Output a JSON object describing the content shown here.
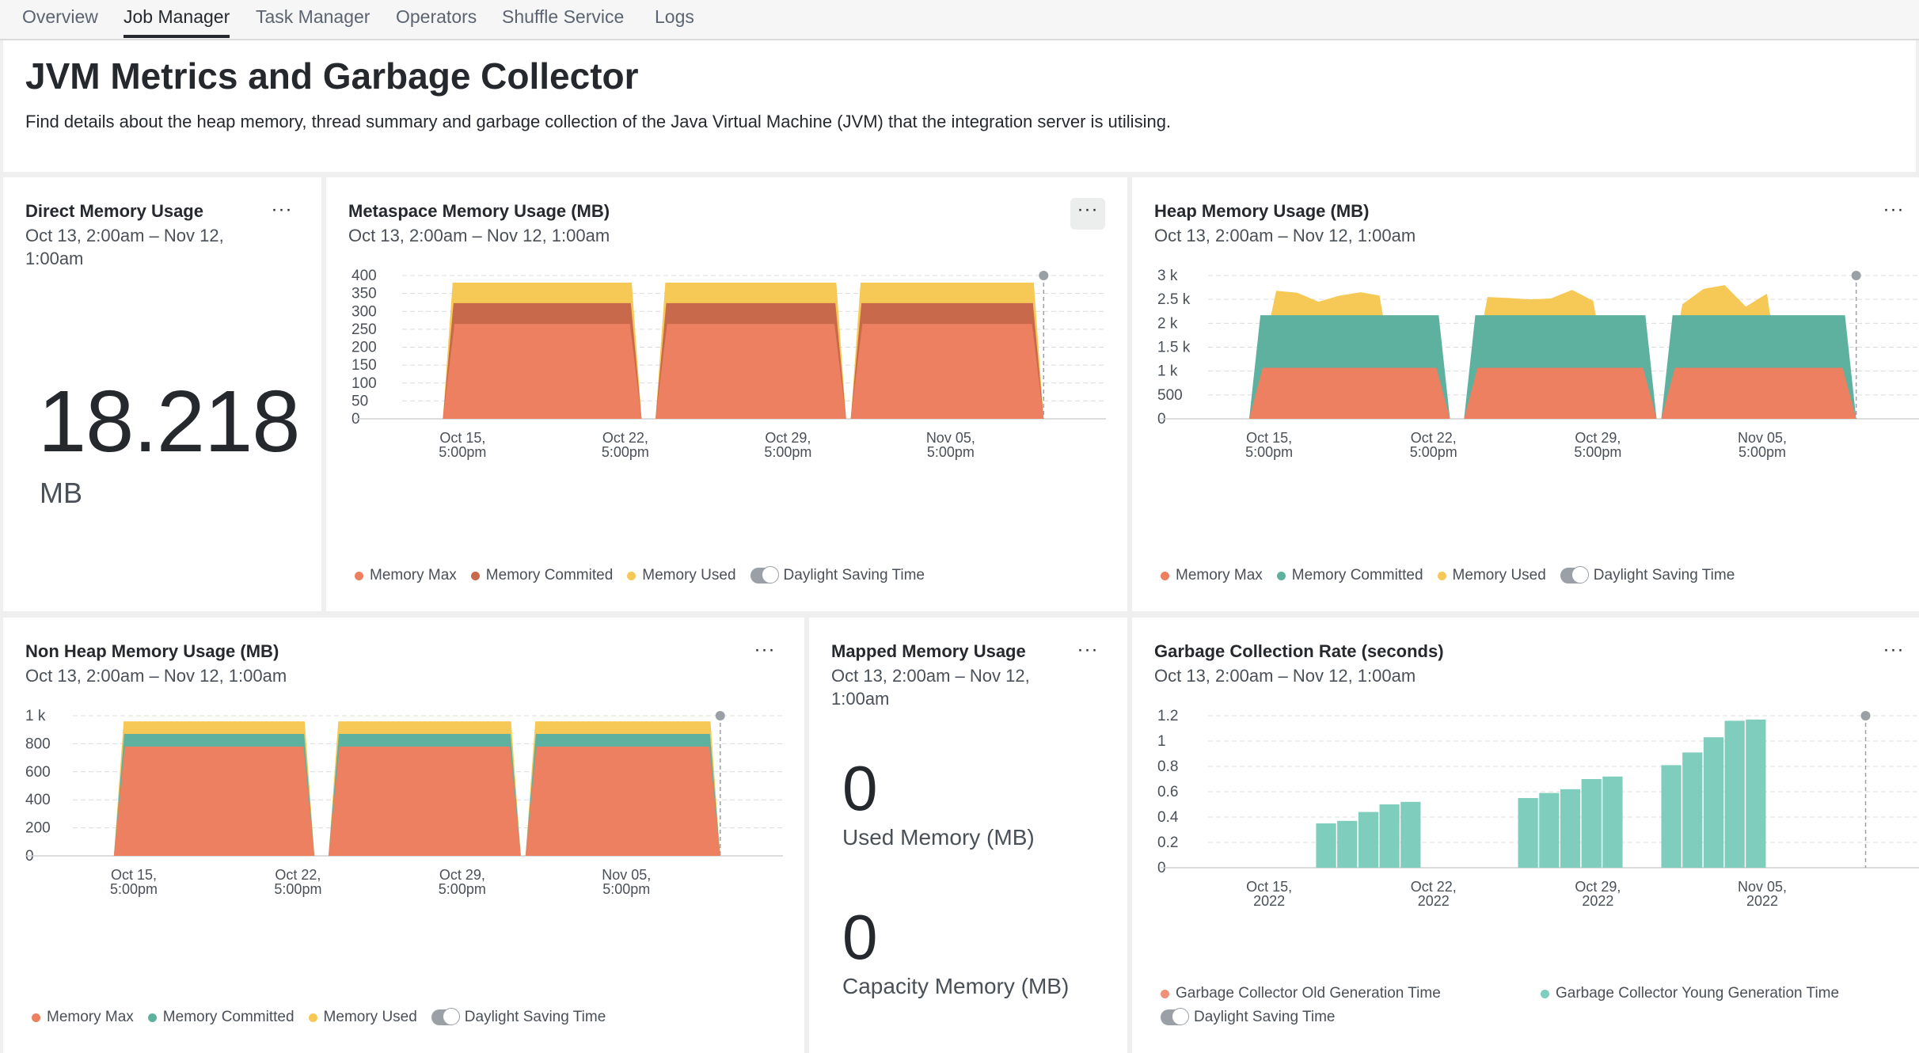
{
  "tabs": [
    {
      "label": "Overview",
      "active": false
    },
    {
      "label": "Job Manager",
      "active": true
    },
    {
      "label": "Task Manager",
      "active": false
    },
    {
      "label": "Operators",
      "active": false
    },
    {
      "label": "Shuffle Service",
      "active": false
    },
    {
      "label": "Logs",
      "active": false
    }
  ],
  "header": {
    "title": "JVM Metrics and Garbage Collector",
    "description": "Find details about the heap memory, thread summary and garbage collection of the Java Virtual Machine (JVM) that the integration server is utilising."
  },
  "menu_glyph": "···",
  "toggle_label": "Daylight Saving Time",
  "colors": {
    "memory_max": "#ec8060",
    "memory_commited_meta": "#c9694c",
    "memory_used": "#f6c957",
    "memory_committed_green": "#5fb19f",
    "gc_young": "#7ecdbd",
    "gc_old": "#f0917a"
  },
  "direct_memory": {
    "title": "Direct Memory Usage",
    "range_line1": "Oct 13, 2:00am – Nov 12,",
    "range_line2": "1:00am",
    "value": "18.218",
    "unit": "MB"
  },
  "metaspace": {
    "title": "Metaspace Memory Usage (MB)",
    "range": "Oct 13, 2:00am – Nov 12, 1:00am",
    "legend": [
      "Memory Max",
      "Memory Commited",
      "Memory Used"
    ]
  },
  "heap": {
    "title": "Heap Memory Usage (MB)",
    "range": "Oct 13, 2:00am – Nov 12, 1:00am",
    "legend": [
      "Memory Max",
      "Memory Committed",
      "Memory Used"
    ]
  },
  "nonheap": {
    "title": "Non Heap Memory Usage (MB)",
    "range": "Oct 13, 2:00am – Nov 12, 1:00am",
    "legend": [
      "Memory Max",
      "Memory Committed",
      "Memory Used"
    ]
  },
  "mapped_memory": {
    "title": "Mapped Memory Usage",
    "range_line1": "Oct 13, 2:00am – Nov 12,",
    "range_line2": "1:00am",
    "used_value": "0",
    "used_label": "Used Memory (MB)",
    "capacity_value": "0",
    "capacity_label": "Capacity Memory (MB)"
  },
  "gc_rate": {
    "title": "Garbage Collection Rate (seconds)",
    "range": "Oct 13, 2:00am – Nov 12, 1:00am",
    "legend": [
      "Garbage Collector Old Generation Time",
      "Garbage Collector Young Generation Time"
    ]
  },
  "chart_data": [
    {
      "id": "metaspace",
      "type": "area",
      "title": "Metaspace Memory Usage (MB)",
      "x_ticks": [
        [
          "Oct 15,",
          "5:00pm"
        ],
        [
          "Oct 22,",
          "5:00pm"
        ],
        [
          "Oct 29,",
          "5:00pm"
        ],
        [
          "Nov 05,",
          "5:00pm"
        ]
      ],
      "y_ticks": [
        "0",
        "50",
        "100",
        "150",
        "200",
        "250",
        "300",
        "350",
        "400"
      ],
      "ylim": [
        0,
        400
      ],
      "segments": [
        [
          1.75,
          10.3
        ],
        [
          10.9,
          19.1
        ],
        [
          19.3,
          27.6
        ]
      ],
      "series": [
        {
          "name": "Memory Max",
          "value": 265
        },
        {
          "name": "Memory Commited",
          "value": 323
        },
        {
          "name": "Memory Used",
          "value": 380
        }
      ],
      "marker_day": 27.6,
      "grid": true,
      "legend_position": "bottom"
    },
    {
      "id": "heap",
      "type": "area",
      "title": "Heap Memory Usage (MB)",
      "x_ticks": [
        [
          "Oct 15,",
          "5:00pm"
        ],
        [
          "Oct 22,",
          "5:00pm"
        ],
        [
          "Oct 29,",
          "5:00pm"
        ],
        [
          "Nov 05,",
          "5:00pm"
        ]
      ],
      "y_ticks": [
        "0",
        "500",
        "1 k",
        "1.5 k",
        "2 k",
        "2.5 k",
        "3 k"
      ],
      "y_values": [
        0,
        500,
        1000,
        1500,
        2000,
        2500,
        3000
      ],
      "ylim": [
        0,
        3000
      ],
      "segments": [
        [
          1.75,
          10.3
        ],
        [
          10.9,
          19.1
        ],
        [
          19.3,
          27.6
        ]
      ],
      "series": [
        {
          "name": "Memory Max",
          "value": 1070
        },
        {
          "name": "Memory Committed",
          "value": 2170
        },
        {
          "name": "Memory Used",
          "points": [
            [
              [
                1.75,
                0
              ],
              [
                2.9,
                2680
              ],
              [
                3.8,
                2640
              ],
              [
                4.7,
                2450
              ],
              [
                5.6,
                2580
              ],
              [
                6.5,
                2650
              ],
              [
                7.3,
                2580
              ],
              [
                8.2,
                0
              ]
            ],
            [
              [
                10.9,
                0
              ],
              [
                11.9,
                2550
              ],
              [
                12.8,
                2530
              ],
              [
                13.7,
                2500
              ],
              [
                14.6,
                2520
              ],
              [
                15.5,
                2700
              ],
              [
                16.4,
                2470
              ],
              [
                17.3,
                0
              ]
            ],
            [
              [
                19.3,
                0
              ],
              [
                20.2,
                2400
              ],
              [
                21.1,
                2720
              ],
              [
                22.0,
                2800
              ],
              [
                22.9,
                2350
              ],
              [
                23.8,
                2620
              ],
              [
                24.6,
                0
              ]
            ]
          ]
        }
      ],
      "marker_day": 27.6,
      "grid": true,
      "legend_position": "bottom"
    },
    {
      "id": "nonheap",
      "type": "area",
      "title": "Non Heap Memory Usage (MB)",
      "x_ticks": [
        [
          "Oct 15,",
          "5:00pm"
        ],
        [
          "Oct 22,",
          "5:00pm"
        ],
        [
          "Oct 29,",
          "5:00pm"
        ],
        [
          "Nov 05,",
          "5:00pm"
        ]
      ],
      "y_ticks": [
        "0",
        "200",
        "400",
        "600",
        "800",
        "1 k"
      ],
      "y_values": [
        0,
        200,
        400,
        600,
        800,
        1000
      ],
      "ylim": [
        0,
        1000
      ],
      "segments": [
        [
          1.75,
          10.3
        ],
        [
          10.9,
          19.1
        ],
        [
          19.3,
          27.6
        ]
      ],
      "series": [
        {
          "name": "Memory Max",
          "value": 780
        },
        {
          "name": "Memory Committed",
          "value": 870
        },
        {
          "name": "Memory Used",
          "value": 960
        }
      ],
      "marker_day": 27.6,
      "grid": true,
      "legend_position": "bottom"
    },
    {
      "id": "gc",
      "type": "bar",
      "title": "Garbage Collection Rate (seconds)",
      "x_ticks": [
        [
          "Oct 15,",
          "2022"
        ],
        [
          "Oct 22,",
          "2022"
        ],
        [
          "Oct 29,",
          "2022"
        ],
        [
          "Nov 05,",
          "2022"
        ]
      ],
      "y_ticks": [
        "0",
        "0.2",
        "0.4",
        "0.6",
        "0.8",
        "1",
        "1.2"
      ],
      "y_values": [
        0,
        0.2,
        0.4,
        0.6,
        0.8,
        1.0,
        1.2
      ],
      "ylim": [
        0,
        1.2
      ],
      "series": [
        {
          "name": "Garbage Collector Young Generation Time",
          "values": [
            0.35,
            0.37,
            0.44,
            0.5,
            0.52,
            0.55,
            0.59,
            0.62,
            0.7,
            0.72,
            0.81,
            0.91,
            1.03,
            1.16,
            1.17
          ]
        },
        {
          "name": "Garbage Collector Old Generation Time",
          "values": [
            0,
            0,
            0,
            0,
            0,
            0,
            0,
            0,
            0,
            0,
            0,
            0,
            0,
            0,
            0
          ]
        }
      ],
      "marker_day": 28,
      "grid": true,
      "legend_position": "bottom"
    }
  ]
}
